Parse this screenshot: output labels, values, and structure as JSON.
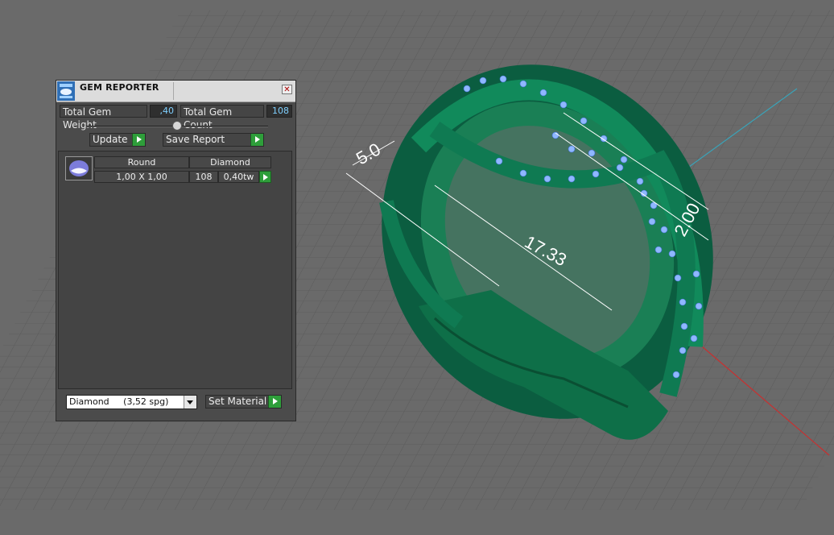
{
  "panel": {
    "title": "GEM REPORTER",
    "close_symbol": "✕",
    "total_weight_label": "Total Gem Weight",
    "total_weight_value": ",40",
    "total_count_label": "Total Gem Count",
    "total_count_value": "108",
    "update_label": "Update",
    "save_report_label": "Save Report",
    "table": {
      "headers": [
        "Round",
        "Diamond"
      ],
      "row": {
        "size": "1,00 X 1,00",
        "count": "108",
        "weight": "0,40tw"
      }
    },
    "material_selected": "Diamond     (3,52 spg)",
    "set_material_label": "Set Material"
  },
  "viewport": {
    "dimensions": [
      "5.0",
      "17.33",
      "2.00"
    ],
    "colors": {
      "grid_bg": "#6a6a6a",
      "grid_line": "#595959",
      "ring": "#0f7a52",
      "gem": "#8fb7ff",
      "axis_x": "#c83030",
      "axis_y": "#3aa3b8"
    }
  }
}
